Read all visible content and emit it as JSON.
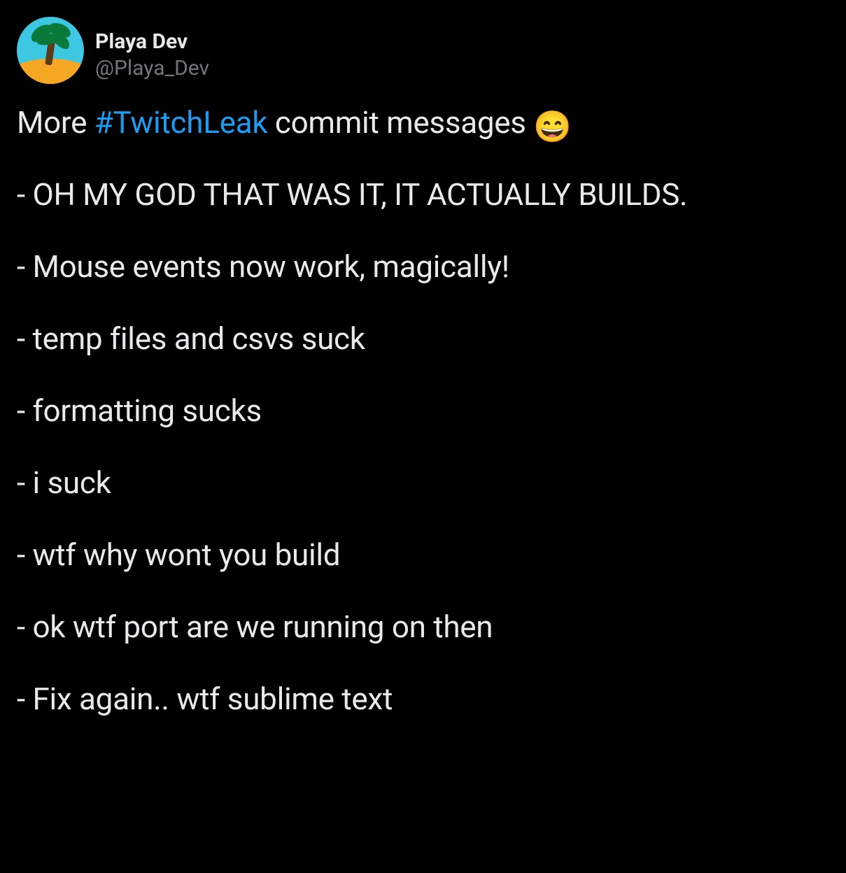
{
  "user": {
    "display_name": "Playa Dev",
    "handle": "@Playa_Dev"
  },
  "tweet": {
    "intro_prefix": "More ",
    "hashtag": "#TwitchLeak",
    "intro_suffix": " commit messages ",
    "emoji": "😄",
    "messages": [
      "- OH MY GOD THAT WAS IT, IT ACTUALLY BUILDS.",
      "- Mouse events now work, magically!",
      "- temp files and csvs suck",
      "- formatting sucks",
      "- i suck",
      "- wtf why wont you build",
      "- ok wtf port are we running on then",
      "- Fix again.. wtf sublime text"
    ]
  }
}
